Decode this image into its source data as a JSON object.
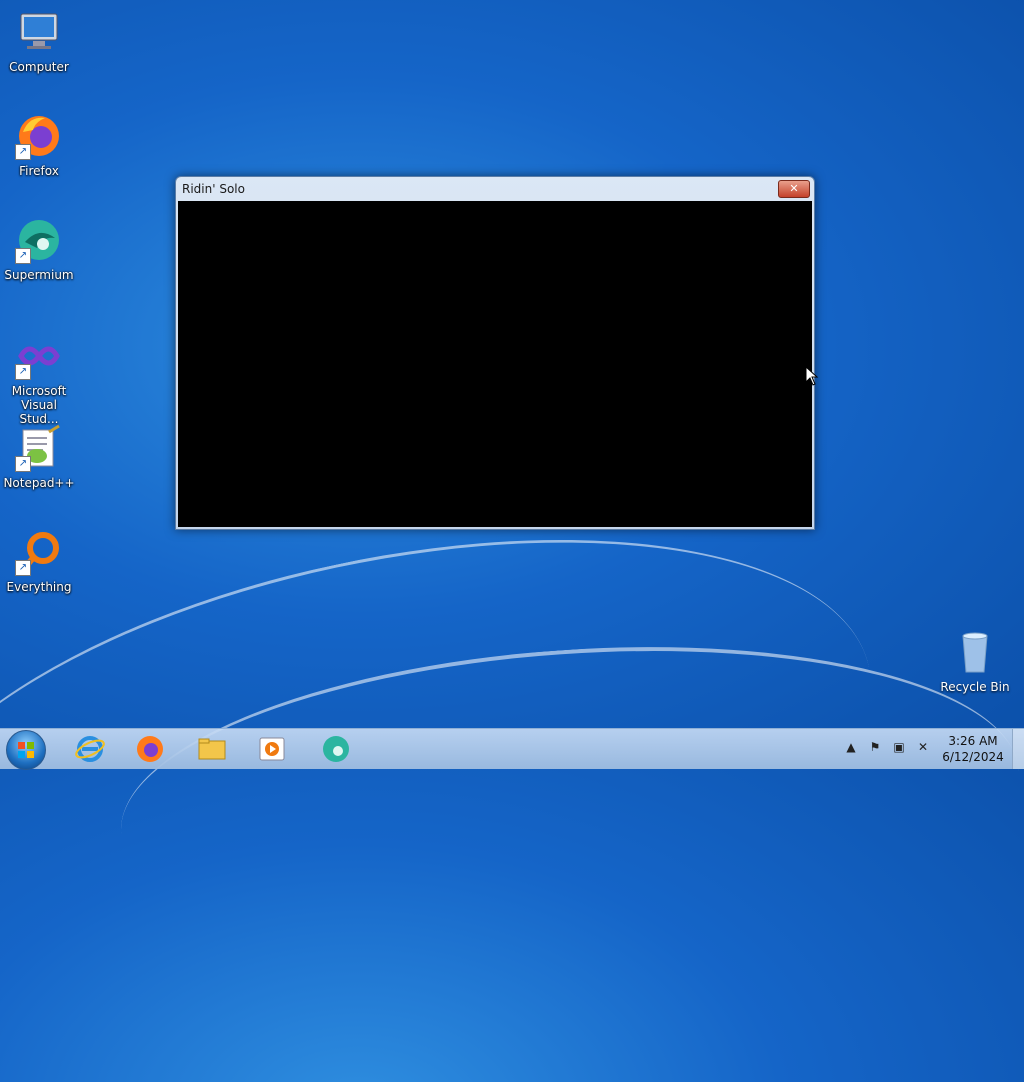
{
  "desktop": {
    "icons": [
      {
        "label": "Computer"
      },
      {
        "label": "Firefox"
      },
      {
        "label": "Supermium"
      },
      {
        "label": "Microsoft Visual Stud..."
      },
      {
        "label": "Notepad++"
      },
      {
        "label": "Everything"
      }
    ],
    "recycle_bin": {
      "label": "Recycle Bin"
    }
  },
  "window": {
    "title": "Ridin' Solo",
    "close_glyph": "✕"
  },
  "taskbar": {
    "items": [
      {
        "name": "internet-explorer"
      },
      {
        "name": "firefox"
      },
      {
        "name": "file-explorer"
      },
      {
        "name": "media-player"
      },
      {
        "name": "supermium"
      }
    ],
    "tray": {
      "time": "3:26 AM",
      "date": "6/12/2024"
    }
  },
  "colors": {
    "desktop_blue": "#1565c8",
    "taskbar": "#a8c4e6"
  }
}
